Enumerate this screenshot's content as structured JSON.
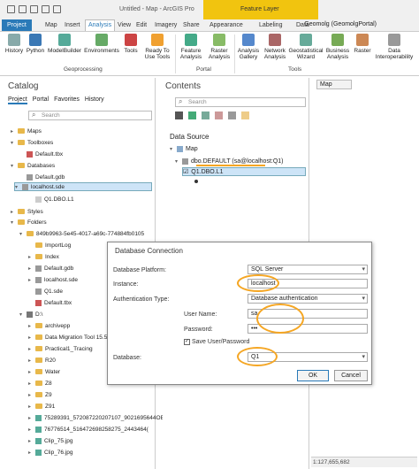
{
  "title_bar": {
    "window_title": "Untitled - Map - ArcGIS Pro",
    "contextual_tab": "Feature Layer"
  },
  "menu_tabs": [
    "Project",
    "Map",
    "Insert",
    "Analysis",
    "View",
    "Edit",
    "Imagery",
    "Share",
    "Appearance",
    "Labeling",
    "Data"
  ],
  "user": "Geomolg (GeomolgPortal)",
  "ribbon": {
    "buttons": [
      "History",
      "Python",
      "ModelBuilder",
      "Environments",
      "Tools",
      "Ready To Use Tools",
      "Feature Analysis",
      "Raster Analysis",
      "Analysis Gallery",
      "Network Analysis",
      "Geostatistical Wizard",
      "Business Analysis",
      "Raster",
      "Data Interoperability"
    ],
    "groups": [
      "Geoprocessing",
      "Portal",
      "Tools"
    ]
  },
  "catalog": {
    "title": "Catalog",
    "tabs": [
      "Project",
      "Portal",
      "Favorites",
      "History"
    ],
    "search_placeholder": "Search",
    "tree": [
      "Maps",
      "Toolboxes",
      "Default.tbx",
      "Databases",
      "Default.gdb",
      "localhost.sde",
      "Q1.DBO.L1",
      "Styles",
      "Folders",
      "849b9963-5e45-4017-a69c-774884fb0105",
      "ImportLog",
      "Index",
      "Default.gdb",
      "localhost.sde",
      "Q1.sde",
      "Default.tbx",
      "D:\\",
      "archivepp",
      "Data Migration Tool 15.5",
      "Practical1_Tracing",
      "R20",
      "Water",
      "Z8",
      "Z9",
      "Z91",
      "75289391_572087220207107_9021695644OE",
      "76776514_516472698258275_2443464(",
      "Clip_75.jpg",
      "Clip_76.jpg"
    ]
  },
  "contents": {
    "title": "Contents",
    "search_placeholder": "Search",
    "section": "Data Source",
    "items": [
      "Map",
      "dbo.DEFAULT (sa@localhost:Q1)",
      "Q1.DBO.L1"
    ]
  },
  "map_tab": "Map",
  "status": {
    "coords": "1:127,655,682"
  },
  "dialog": {
    "title": "Database Connection",
    "platform_label": "Database Platform:",
    "platform_value": "SQL Server",
    "instance_label": "Instance:",
    "instance_value": "localhost",
    "auth_label": "Authentication Type:",
    "auth_value": "Database authentication",
    "username_label": "User Name:",
    "username_value": "sa",
    "password_label": "Password:",
    "password_value": "•••",
    "save_label": "Save User/Password",
    "database_label": "Database:",
    "database_value": "Q1",
    "ok": "OK",
    "cancel": "Cancel"
  },
  "colors": {
    "accent": "#2a7ab8",
    "highlight": "#f5a623",
    "contextual": "#f1c40f"
  }
}
